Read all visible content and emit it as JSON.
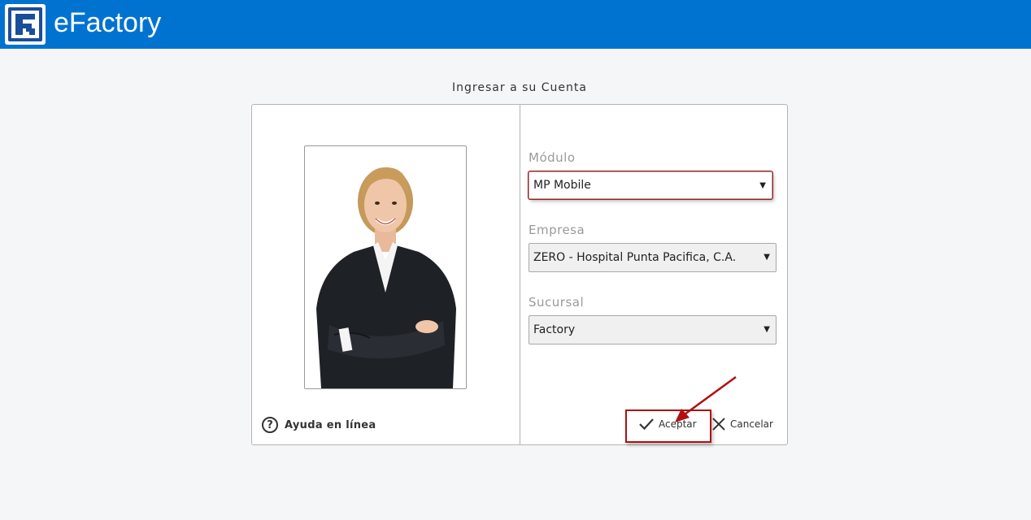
{
  "app": {
    "brand": "eFactory"
  },
  "login": {
    "title": "Ingresar a su Cuenta",
    "help_label": "Ayuda en línea",
    "modulo": {
      "label": "Módulo",
      "value": "MP Mobile"
    },
    "empresa": {
      "label": "Empresa",
      "value": "ZERO - Hospital Punta Pacifica, C.A."
    },
    "sucursal": {
      "label": "Sucursal",
      "value": "Factory"
    },
    "accept_label": "Aceptar",
    "cancel_label": "Cancelar"
  },
  "colors": {
    "header": "#0073d1",
    "highlight": "#b01010"
  }
}
